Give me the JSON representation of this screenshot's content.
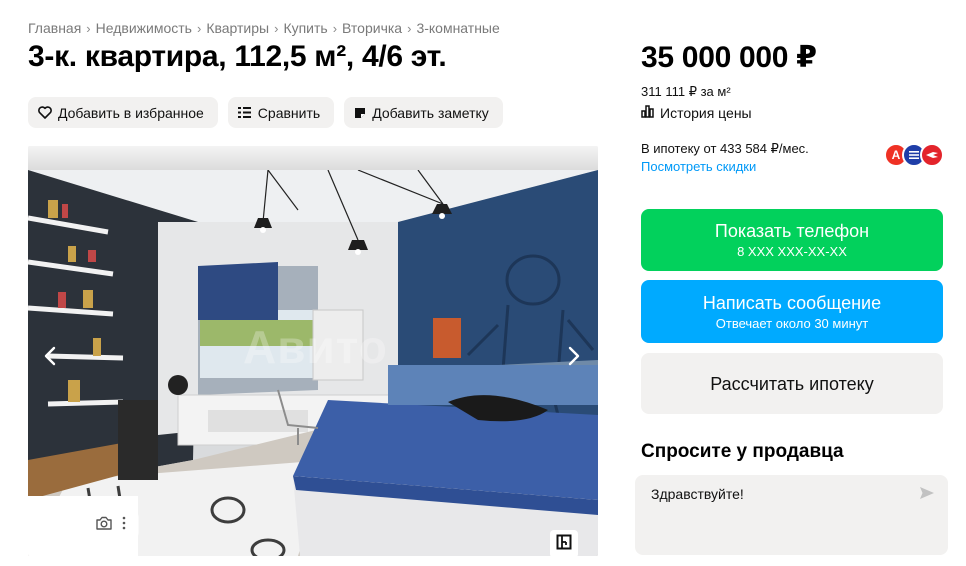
{
  "breadcrumb": {
    "items": [
      "Главная",
      "Недвижимость",
      "Квартиры",
      "Купить",
      "Вторичка",
      "3-комнатные"
    ],
    "separator": "›"
  },
  "listing": {
    "title": "3-к. квартира, 112,5 м², 4/6 эт.",
    "price": "35 000 000 ₽",
    "price_per_m": "311 111 ₽ за м²",
    "price_history": "История цены"
  },
  "actions": {
    "favorite": "Добавить в избранное",
    "compare": "Сравнить",
    "note": "Добавить заметку"
  },
  "gallery": {
    "watermark": "Авито",
    "prev_icon": "chevron-left-icon",
    "next_icon": "chevron-right-icon",
    "camera_icon": "camera-icon",
    "plan_icon": "floor-plan-icon"
  },
  "mortgage": {
    "line": "В ипотеку от 433 584 ₽/мес.",
    "discounts": "Посмотреть скидки",
    "bank_letters": [
      "А",
      "",
      ""
    ]
  },
  "buttons": {
    "phone_main": "Показать телефон",
    "phone_sub": "8 XXX XXX-XX-XX",
    "message_main": "Написать сообщение",
    "message_sub": "Отвечает около 30 минут",
    "mortgage": "Рассчитать ипотеку"
  },
  "seller": {
    "ask_title": "Спросите у продавца",
    "message_value": "Здравствуйте!"
  },
  "colors": {
    "green": "#02d15c",
    "blue": "#00aaff",
    "link": "#0099f7",
    "alfa_red": "#ef3124",
    "bank_blue": "#1f3ea8",
    "bank_red": "#e3242b"
  }
}
